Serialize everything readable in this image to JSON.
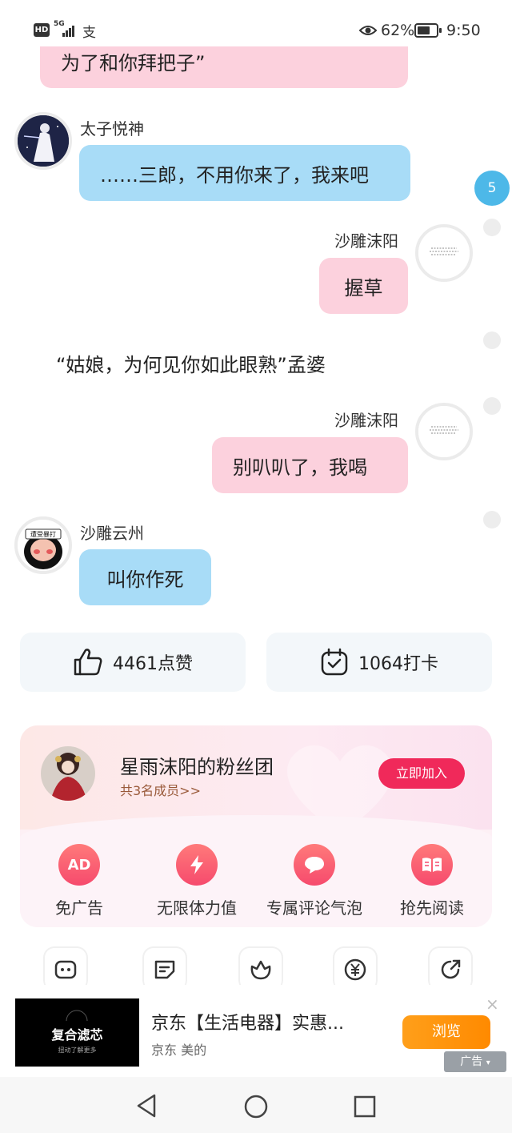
{
  "status_bar": {
    "hd": "HD",
    "network": "5G",
    "carrier_icon": "支",
    "battery_percent": "62%",
    "time": "9:50",
    "battery_level": 0.62
  },
  "chat": {
    "top_bubble": "为了和你拜把子”",
    "messages": [
      {
        "sender": "太子悦神",
        "text": "……三郎，不用你来了，我来吧"
      },
      {
        "sender": "沙雕沫阳",
        "text": "握草"
      },
      {
        "narration": "“姑娘，为何见你如此眼熟”孟婆"
      },
      {
        "sender": "沙雕沫阳",
        "text": "别叭叭了，我喝"
      },
      {
        "sender": "沙雕云州",
        "text": "叫你作死"
      }
    ],
    "unread_badge": "5",
    "avatar_text": {
      "sticker_banner": "遭受暴打"
    }
  },
  "stats": {
    "likes": "4461点赞",
    "checkins": "1064打卡"
  },
  "fan_club": {
    "title": "星雨沫阳的粉丝团",
    "members": "共3名成员>>",
    "join_button": "立即加入",
    "perks": [
      {
        "label": "免广告",
        "icon": "ad-icon",
        "icon_text": "AD"
      },
      {
        "label": "无限体力值",
        "icon": "lightning-icon"
      },
      {
        "label": "专属评论气泡",
        "icon": "comment-bubble-icon"
      },
      {
        "label": "抢先阅读",
        "icon": "book-icon"
      }
    ]
  },
  "tools": [
    "chat-bot-icon",
    "note-icon",
    "flower-icon",
    "yuan-icon",
    "share-icon"
  ],
  "ad": {
    "image_title": "复合滤芯",
    "image_subtitle": "扭动了解更多",
    "title": "京东【生活电器】实惠...",
    "subtitle": "京东 美的",
    "button": "浏览",
    "close": "×",
    "tag": "广告"
  },
  "colors": {
    "pink_bubble": "#fcd1dd",
    "blue_bubble": "#a8dcf7",
    "join_button": "#f0295a",
    "ad_button": "#ff8a00",
    "badge": "#4db8e8"
  }
}
